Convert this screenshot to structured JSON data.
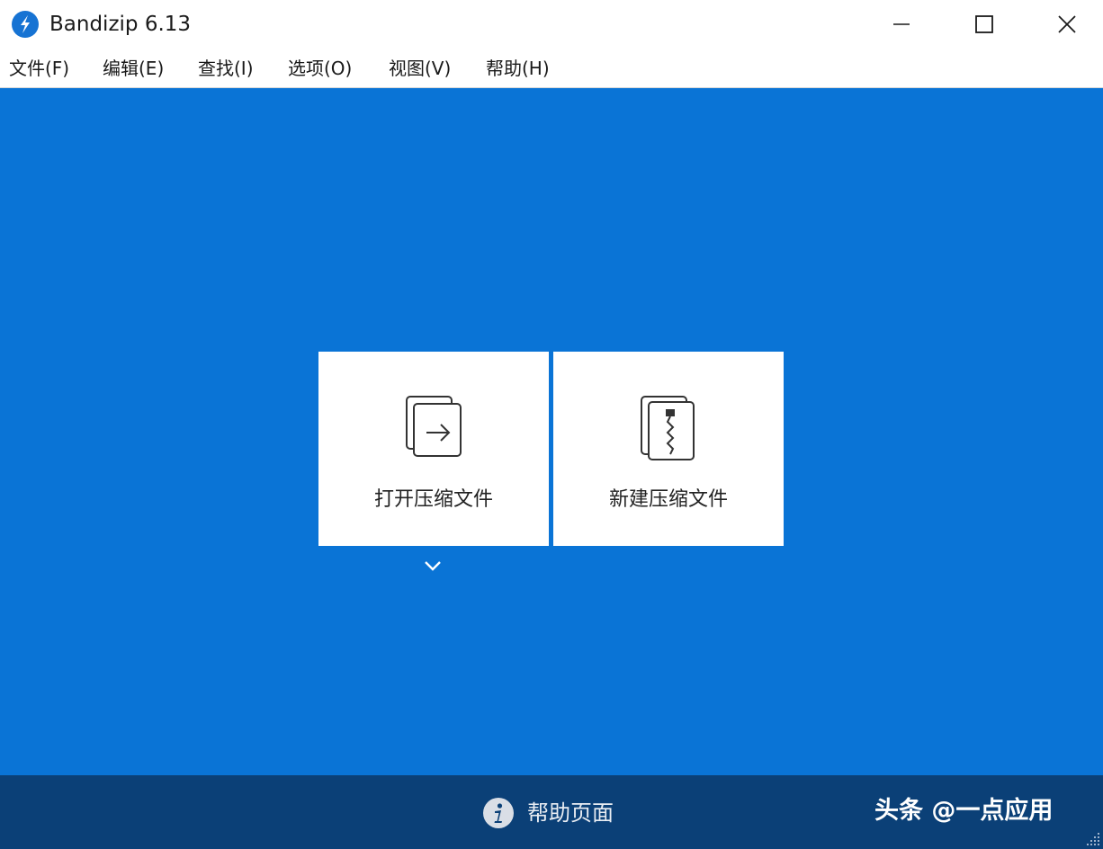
{
  "window": {
    "title": "Bandizip 6.13",
    "icon": "bandizip-logo-icon"
  },
  "controls": {
    "minimize_icon": "minimize-icon",
    "maximize_icon": "maximize-icon",
    "close_icon": "close-icon"
  },
  "menu": {
    "items": [
      {
        "label": "文件(F)"
      },
      {
        "label": "编辑(E)"
      },
      {
        "label": "查找(I)"
      },
      {
        "label": "选项(O)"
      },
      {
        "label": "视图(V)"
      },
      {
        "label": "帮助(H)"
      }
    ]
  },
  "actions": {
    "open_archive": {
      "label": "打开压缩文件",
      "icon": "open-archive-icon"
    },
    "new_archive": {
      "label": "新建压缩文件",
      "icon": "zip-archive-icon"
    },
    "more_icon": "chevron-down-icon"
  },
  "footer": {
    "help_label": "帮助页面",
    "help_icon": "info-icon",
    "watermark": "头条 @一点应用"
  },
  "colors": {
    "main_background": "#0a74d6",
    "footer_background": "#0b4077",
    "card_background": "#ffffff"
  }
}
